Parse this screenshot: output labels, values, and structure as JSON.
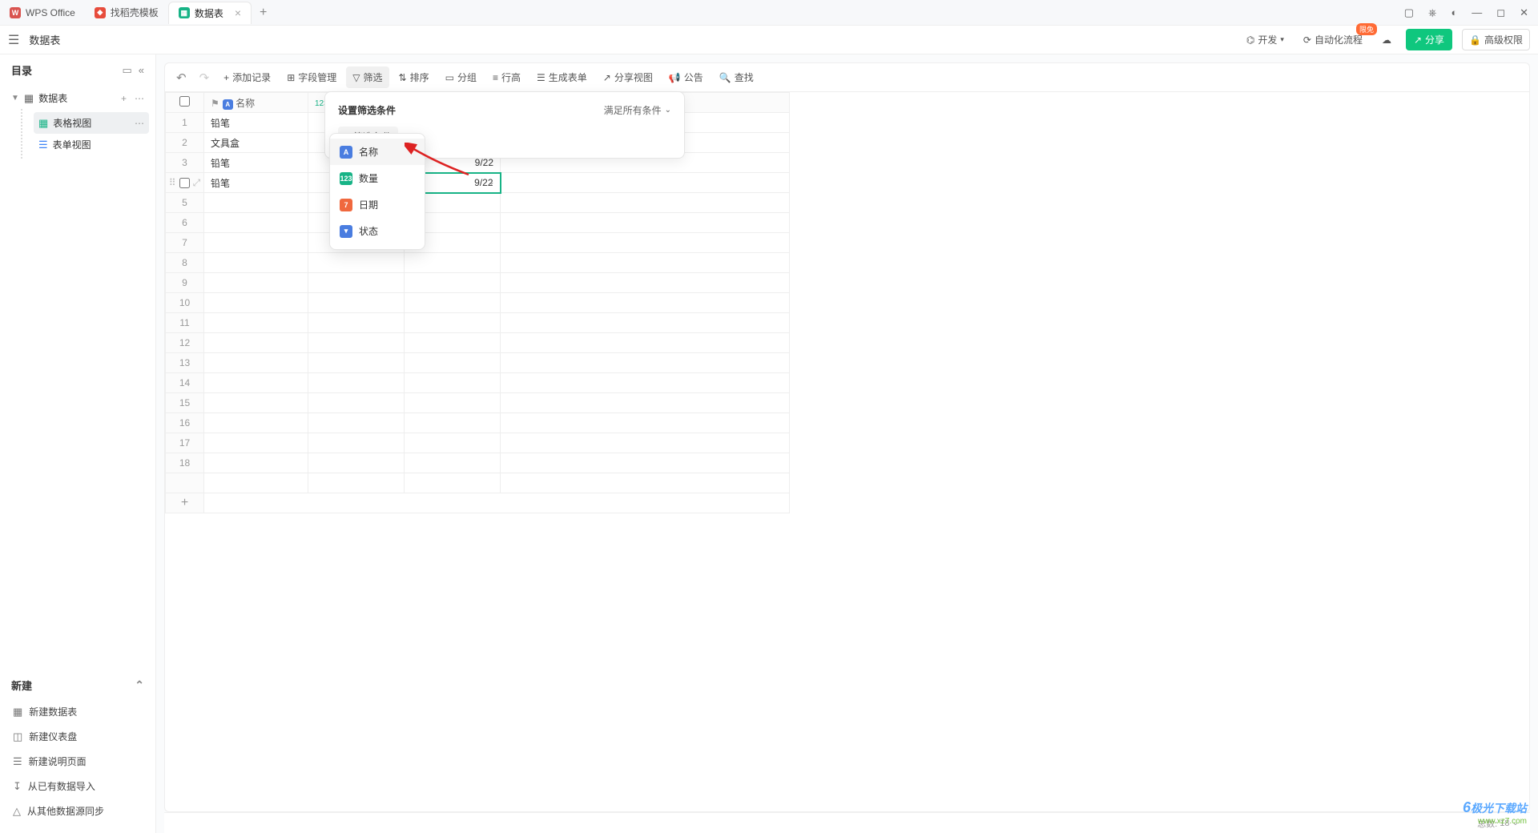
{
  "tabs": [
    {
      "label": "WPS Office",
      "icon": "wps"
    },
    {
      "label": "找稻壳模板",
      "icon": "find"
    },
    {
      "label": "数据表",
      "icon": "table",
      "active": true
    }
  ],
  "appbar": {
    "doc_name": "数据表",
    "dev": "开发",
    "auto": "自动化流程",
    "share": "分享",
    "perm": "高级权限"
  },
  "sidebar": {
    "title": "目录",
    "root": "数据表",
    "views": [
      {
        "label": "表格视图",
        "icon": "grid",
        "active": true
      },
      {
        "label": "表单视图",
        "icon": "form"
      }
    ],
    "new_section": "新建",
    "new_items": [
      "新建数据表",
      "新建仪表盘",
      "新建说明页面",
      "从已有数据导入",
      "从其他数据源同步"
    ]
  },
  "toolbar": {
    "add_record": "添加记录",
    "field_mgmt": "字段管理",
    "filter": "筛选",
    "sort": "排序",
    "group": "分组",
    "row_height": "行高",
    "gen_form": "生成表单",
    "share_view": "分享视图",
    "notice": "公告",
    "find": "查找"
  },
  "grid": {
    "header_name": "名称",
    "rows": [
      "铅笔",
      "文具盒",
      "铅笔",
      "铅笔"
    ],
    "date_partial": "9/22",
    "date_partial2": "9/22",
    "total_rows": 18
  },
  "popover": {
    "title": "设置筛选条件",
    "match_all": "满足所有条件",
    "add_btn": "筛选条件"
  },
  "field_options": [
    {
      "label": "名称",
      "icon": "text"
    },
    {
      "label": "数量",
      "icon": "num"
    },
    {
      "label": "日期",
      "icon": "date"
    },
    {
      "label": "状态",
      "icon": "status"
    }
  ],
  "status": {
    "total_label": "总数:",
    "total": "18"
  },
  "watermark": {
    "l1": "极光下载站",
    "l2": "www.xz7.com"
  }
}
